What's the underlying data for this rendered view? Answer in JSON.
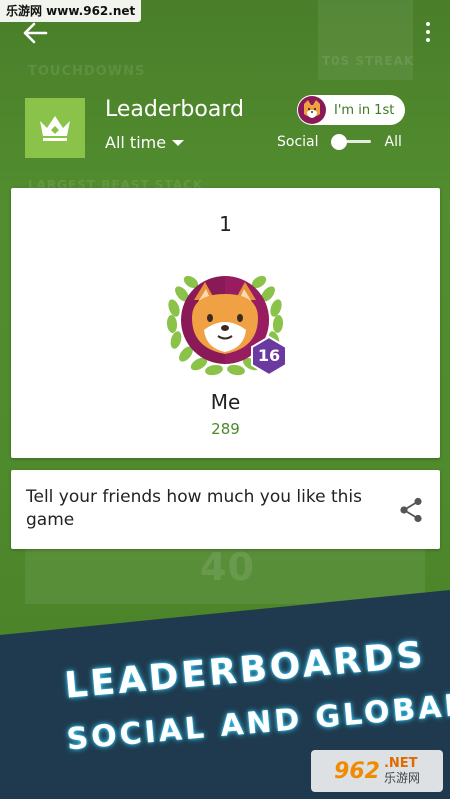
{
  "watermark_top": "乐游网 www.962.net",
  "background_ghost": {
    "touchdowns_label": "TOUCHDOWNS",
    "streak_label": "LARGEST BEAST STACK",
    "big_number": "40",
    "top_right_text": "T0S STREAK"
  },
  "header": {
    "back_icon": "arrow-left-icon",
    "more_icon": "more-vertical-icon"
  },
  "leaderboard": {
    "title": "Leaderboard",
    "time_filter": "All time",
    "im_first_label": "I'm in 1st",
    "toggle_left_label": "Social",
    "toggle_right_label": "All",
    "toggle_state": "social"
  },
  "player_card": {
    "rank": "1",
    "level": "16",
    "name": "Me",
    "score": "289"
  },
  "share": {
    "text": "Tell your friends how much you like this game",
    "icon": "share-icon"
  },
  "promo": {
    "line1": "LEADERBOARDS",
    "line2": "SOCIAL AND GLOBAL"
  },
  "watermark_bottom": {
    "number": "962",
    "net": ".NET",
    "chinese": "乐游网"
  },
  "colors": {
    "background_green": "#4e8a2c",
    "tile_green": "#8bc34a",
    "score_green": "#4a8a2a",
    "avatar_maroon": "#8a1a57",
    "level_purple": "#6a3aa0",
    "banner_navy": "#1f3a4e"
  }
}
